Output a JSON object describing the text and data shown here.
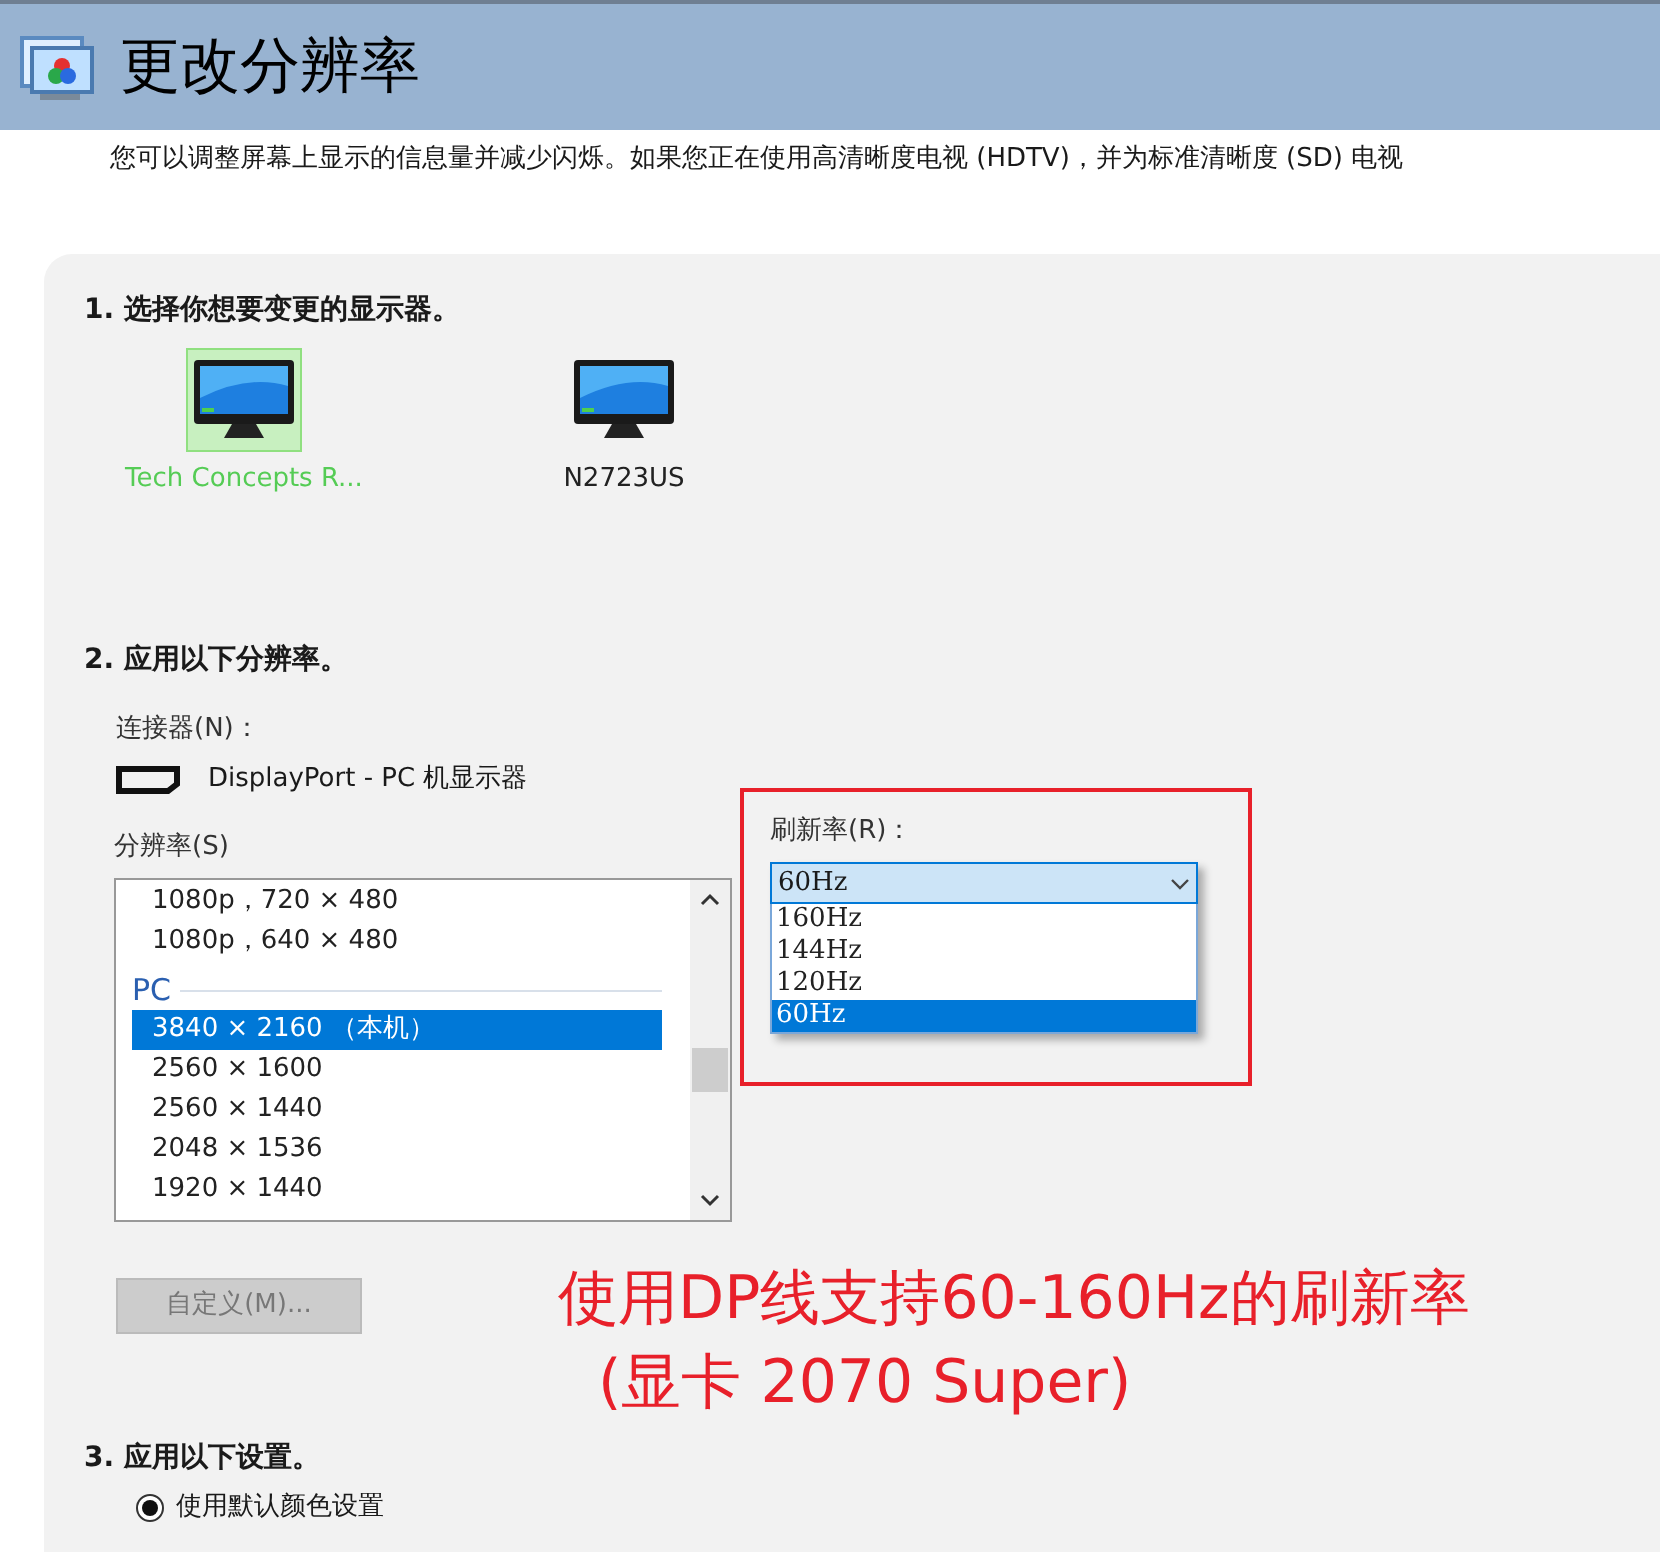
{
  "header": {
    "title": "更改分辨率"
  },
  "description": "您可以调整屏幕上显示的信息量并减少闪烁。如果您正在使用高清晰度电视 (HDTV)，并为标准清晰度 (SD) 电视",
  "step1": {
    "heading": "1. 选择你想要变更的显示器。",
    "monitors": [
      {
        "label": "Tech Concepts R...",
        "selected": true
      },
      {
        "label": "N2723US",
        "selected": false
      }
    ]
  },
  "step2": {
    "heading": "2. 应用以下分辨率。",
    "connector_label": "连接器(N)：",
    "connector": "DisplayPort - PC 机显示器",
    "resolution_label": "分辨率(S)",
    "resolutions": [
      {
        "kind": "item",
        "label": "1080p，720 × 480",
        "selected": false
      },
      {
        "kind": "item",
        "label": "1080p，640 × 480",
        "selected": false
      },
      {
        "kind": "group",
        "label": "PC"
      },
      {
        "kind": "item",
        "label": "3840 × 2160 （本机）",
        "selected": true
      },
      {
        "kind": "item",
        "label": "2560 × 1600",
        "selected": false
      },
      {
        "kind": "item",
        "label": "2560 × 1440",
        "selected": false
      },
      {
        "kind": "item",
        "label": "2048 × 1536",
        "selected": false
      },
      {
        "kind": "item",
        "label": "1920 × 1440",
        "selected": false
      }
    ],
    "refresh_label": "刷新率(R)：",
    "refresh_value": "60Hz",
    "refresh_options": [
      {
        "label": "160Hz",
        "selected": false
      },
      {
        "label": "144Hz",
        "selected": false
      },
      {
        "label": "120Hz",
        "selected": false
      },
      {
        "label": "60Hz",
        "selected": true
      }
    ],
    "custom_button": {
      "label": "自定义(M)...",
      "disabled": true
    }
  },
  "annotation": [
    "使用DP线支持60-160Hz的刷新率",
    "(显卡 2070 Super)"
  ],
  "step3": {
    "heading": "3. 应用以下设置。",
    "options": [
      {
        "label": "使用默认颜色设置",
        "selected": true
      }
    ]
  }
}
